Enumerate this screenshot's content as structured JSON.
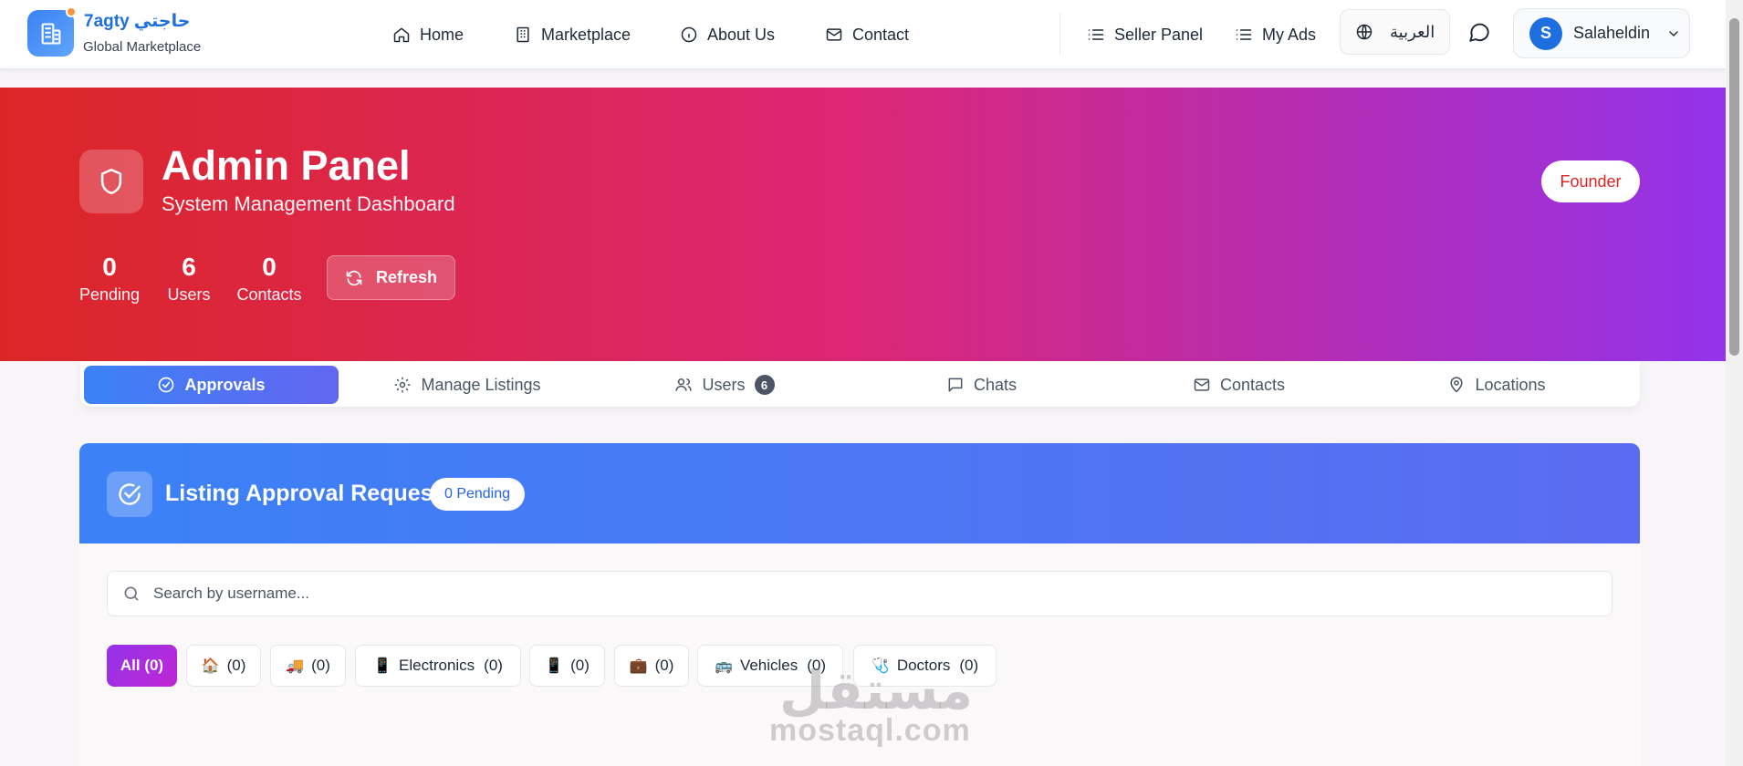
{
  "nav": {
    "brand_name": "7agty حاجتي",
    "brand_sub": "Global Marketplace",
    "links": [
      {
        "label": "Home",
        "icon": "home-icon"
      },
      {
        "label": "Marketplace",
        "icon": "building-icon"
      },
      {
        "label": "About Us",
        "icon": "info-icon"
      },
      {
        "label": "Contact",
        "icon": "mail-icon"
      }
    ],
    "seller_panel": "Seller Panel",
    "my_ads": "My Ads",
    "language": "العربية",
    "user_initial": "S",
    "user_name": "Salaheldin"
  },
  "hero": {
    "title": "Admin Panel",
    "subtitle": "System Management Dashboard",
    "stats": [
      {
        "value": "0",
        "label": "Pending"
      },
      {
        "value": "6",
        "label": "Users"
      },
      {
        "value": "0",
        "label": "Contacts"
      }
    ],
    "refresh_label": "Refresh",
    "role_badge": "Founder"
  },
  "tabs": [
    {
      "label": "Approvals",
      "icon": "check-circle-icon",
      "active": true
    },
    {
      "label": "Manage Listings",
      "icon": "gear-icon"
    },
    {
      "label": "Users",
      "icon": "users-icon",
      "badge": "6"
    },
    {
      "label": "Chats",
      "icon": "chat-icon"
    },
    {
      "label": "Contacts",
      "icon": "mail-icon"
    },
    {
      "label": "Locations",
      "icon": "map-pin-icon"
    }
  ],
  "approvals": {
    "title": "Listing Approval Requests",
    "pending_badge": "0 Pending",
    "search_placeholder": "Search by username...",
    "filters": [
      {
        "label": "All (0)",
        "emoji": ""
      },
      {
        "label": "(0)",
        "emoji": "🏠"
      },
      {
        "label": "(0)",
        "emoji": "🚚"
      },
      {
        "label": "Electronics",
        "count": "(0)",
        "emoji": "📱"
      },
      {
        "label": "(0)",
        "emoji": "📱"
      },
      {
        "label": "(0)",
        "emoji": "💼"
      },
      {
        "label": "Vehicles",
        "count": "(0)",
        "emoji": "🚌"
      },
      {
        "label": "Doctors",
        "count": "(0)",
        "emoji": "🩺"
      }
    ]
  },
  "watermark": {
    "arabic": "مستقل",
    "latin": "mostaql.com"
  },
  "colors": {
    "brand_blue": "#1d6fe0",
    "hero_start": "#dc2626",
    "hero_mid": "#db2777",
    "hero_end": "#9333ea",
    "tab_active": "#3b82f6",
    "chip_active": "#9333ea"
  }
}
